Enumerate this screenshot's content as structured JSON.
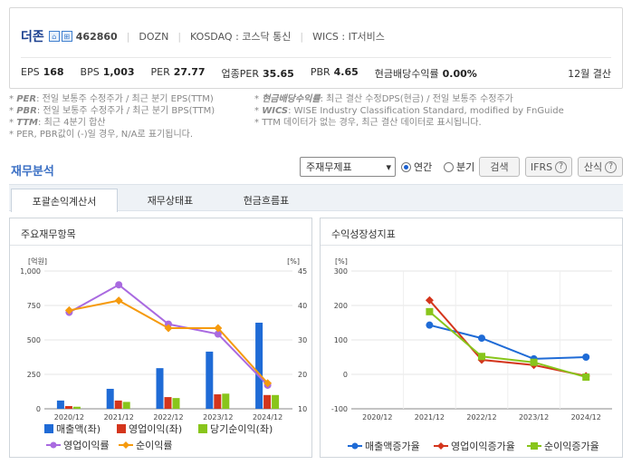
{
  "company": {
    "name": "더존",
    "badges": [
      "⌂",
      "⊞"
    ],
    "code": "462860",
    "ticker": "DOZN",
    "market": "KOSDAQ : 코스닥 통신",
    "wics": "WICS : IT서비스"
  },
  "stats": [
    {
      "label": "EPS",
      "value": "168"
    },
    {
      "label": "BPS",
      "value": "1,003"
    },
    {
      "label": "PER",
      "value": "27.77"
    },
    {
      "label": "업종PER",
      "value": "35.65"
    },
    {
      "label": "PBR",
      "value": "4.65"
    },
    {
      "label": "현금배당수익률",
      "value": "0.00%"
    }
  ],
  "settlement": "12월 결산",
  "notes_left": [
    {
      "key": "PER",
      "text": ": 전일 보통주 수정주가 / 최근 분기 EPS(TTM)"
    },
    {
      "key": "PBR",
      "text": ": 전일 보통주 수정주가 / 최근 분기 BPS(TTM)"
    },
    {
      "key": "TTM",
      "text": ": 최근 4분기 합산"
    },
    {
      "key": "",
      "text": "PER, PBR값이 (-)일 경우, N/A로 표기됩니다."
    }
  ],
  "notes_right": [
    {
      "key": "현금배당수익률",
      "text": ": 최근 결산 수정DPS(현금) / 전일 보통주 수정주가"
    },
    {
      "key": "WICS",
      "text": ": WISE Industry Classification Standard, modified by FnGuide"
    },
    {
      "key": "",
      "text": "TTM 데이터가 없는 경우, 최근 결산 데이터로 표시됩니다."
    }
  ],
  "section_title": "재무분석",
  "controls": {
    "select_value": "주재무제표",
    "annual": "연간",
    "quarter": "분기",
    "search": "검색",
    "ifrs": "IFRS",
    "calc": "산식",
    "help": "?"
  },
  "tabs": [
    "포괄손익계산서",
    "재무상태표",
    "현금흐름표"
  ],
  "left_panel": {
    "title": "주요재무항목"
  },
  "right_panel": {
    "title": "수익성장성지표"
  },
  "colors": {
    "revenue": "#1f6bd6",
    "op_income": "#d4351c",
    "net_income": "#88c51b",
    "op_margin": "#a96ae0",
    "net_margin": "#f59a0e",
    "accent": "#3a6fc4"
  },
  "chart_data": [
    {
      "type": "bar",
      "categories": [
        "2020/12",
        "2021/12",
        "2022/12",
        "2023/12",
        "2024/12"
      ],
      "yunit_left": "[억원]",
      "yunit_right": "[%]",
      "ylim": [
        0,
        1000
      ],
      "ylim_right": [
        10,
        45
      ],
      "yticks_left": [
        "0",
        "250",
        "500",
        "750",
        "1,000"
      ],
      "yticks_right": [
        "10",
        "20",
        "30",
        "40",
        "45"
      ],
      "series": [
        {
          "name": "매출액(좌)",
          "kind": "bar",
          "axis": "left",
          "values": [
            60,
            145,
            295,
            415,
            625
          ]
        },
        {
          "name": "영업이익(좌)",
          "kind": "bar",
          "axis": "left",
          "values": [
            20,
            60,
            85,
            105,
            100
          ]
        },
        {
          "name": "당기순이익(좌)",
          "kind": "bar",
          "axis": "left",
          "values": [
            15,
            50,
            78,
            110,
            100
          ]
        },
        {
          "name": "영업이익률",
          "kind": "line",
          "axis": "right",
          "values": [
            34.5,
            41.5,
            31.5,
            29,
            16
          ]
        },
        {
          "name": "순이익률",
          "kind": "line",
          "axis": "right",
          "values": [
            35.0,
            37.5,
            30.5,
            30.5,
            16.5
          ]
        }
      ]
    },
    {
      "type": "line",
      "categories": [
        "2020/12",
        "2021/12",
        "2022/12",
        "2023/12",
        "2024/12"
      ],
      "yunit_left": "[%]",
      "ylim": [
        -100,
        300
      ],
      "yticks_left": [
        "-100",
        "0",
        "100",
        "200",
        "300"
      ],
      "series": [
        {
          "name": "매출액증가율",
          "values": [
            null,
            143,
            105,
            45,
            50
          ]
        },
        {
          "name": "영업이익증가율",
          "values": [
            null,
            215,
            42,
            27,
            -5
          ]
        },
        {
          "name": "순이익증가율",
          "values": [
            null,
            182,
            52,
            35,
            -8
          ]
        }
      ]
    }
  ]
}
